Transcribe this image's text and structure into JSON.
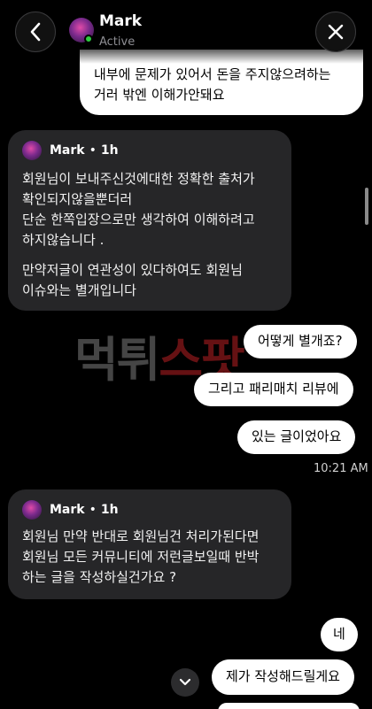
{
  "header": {
    "contact_name": "Mark",
    "status": "Active"
  },
  "messages_out_top": {
    "lines": [
      "내부에 문제가 있어서 돈을 주지않으려하는",
      "거러 밖엔 이해가안돼요"
    ]
  },
  "card1": {
    "sender": "Mark",
    "time": "1h",
    "paragraph1": [
      "회원님이 보내주신것에대한 정확한 출처가",
      "확인되지않을뿐더러",
      "단순 한쪽입장으로만 생각하여 이해하려고",
      "하지않습니다 ."
    ],
    "paragraph2": [
      "만약저글이 연관성이 있다하여도 회원님",
      "이슈와는 별개입니다"
    ]
  },
  "out_group1": [
    "어떻게 별개죠?",
    "그리고 패리매치 리뷰에",
    "있는 글이었아요"
  ],
  "timestamp": "10:21 AM",
  "card2": {
    "sender": "Mark",
    "time": "1h",
    "lines": [
      "회원님 만약 반대로 회원님건 처리가된다면",
      "회원님 모든 커뮤니티에 저런글보일때 반박",
      "하는 글을 작성하실건가요 ?"
    ]
  },
  "out_group2": [
    "네",
    "제가 작성해드릴게요"
  ],
  "watermark": {
    "part1": "먹튀",
    "part2": "스팟"
  }
}
